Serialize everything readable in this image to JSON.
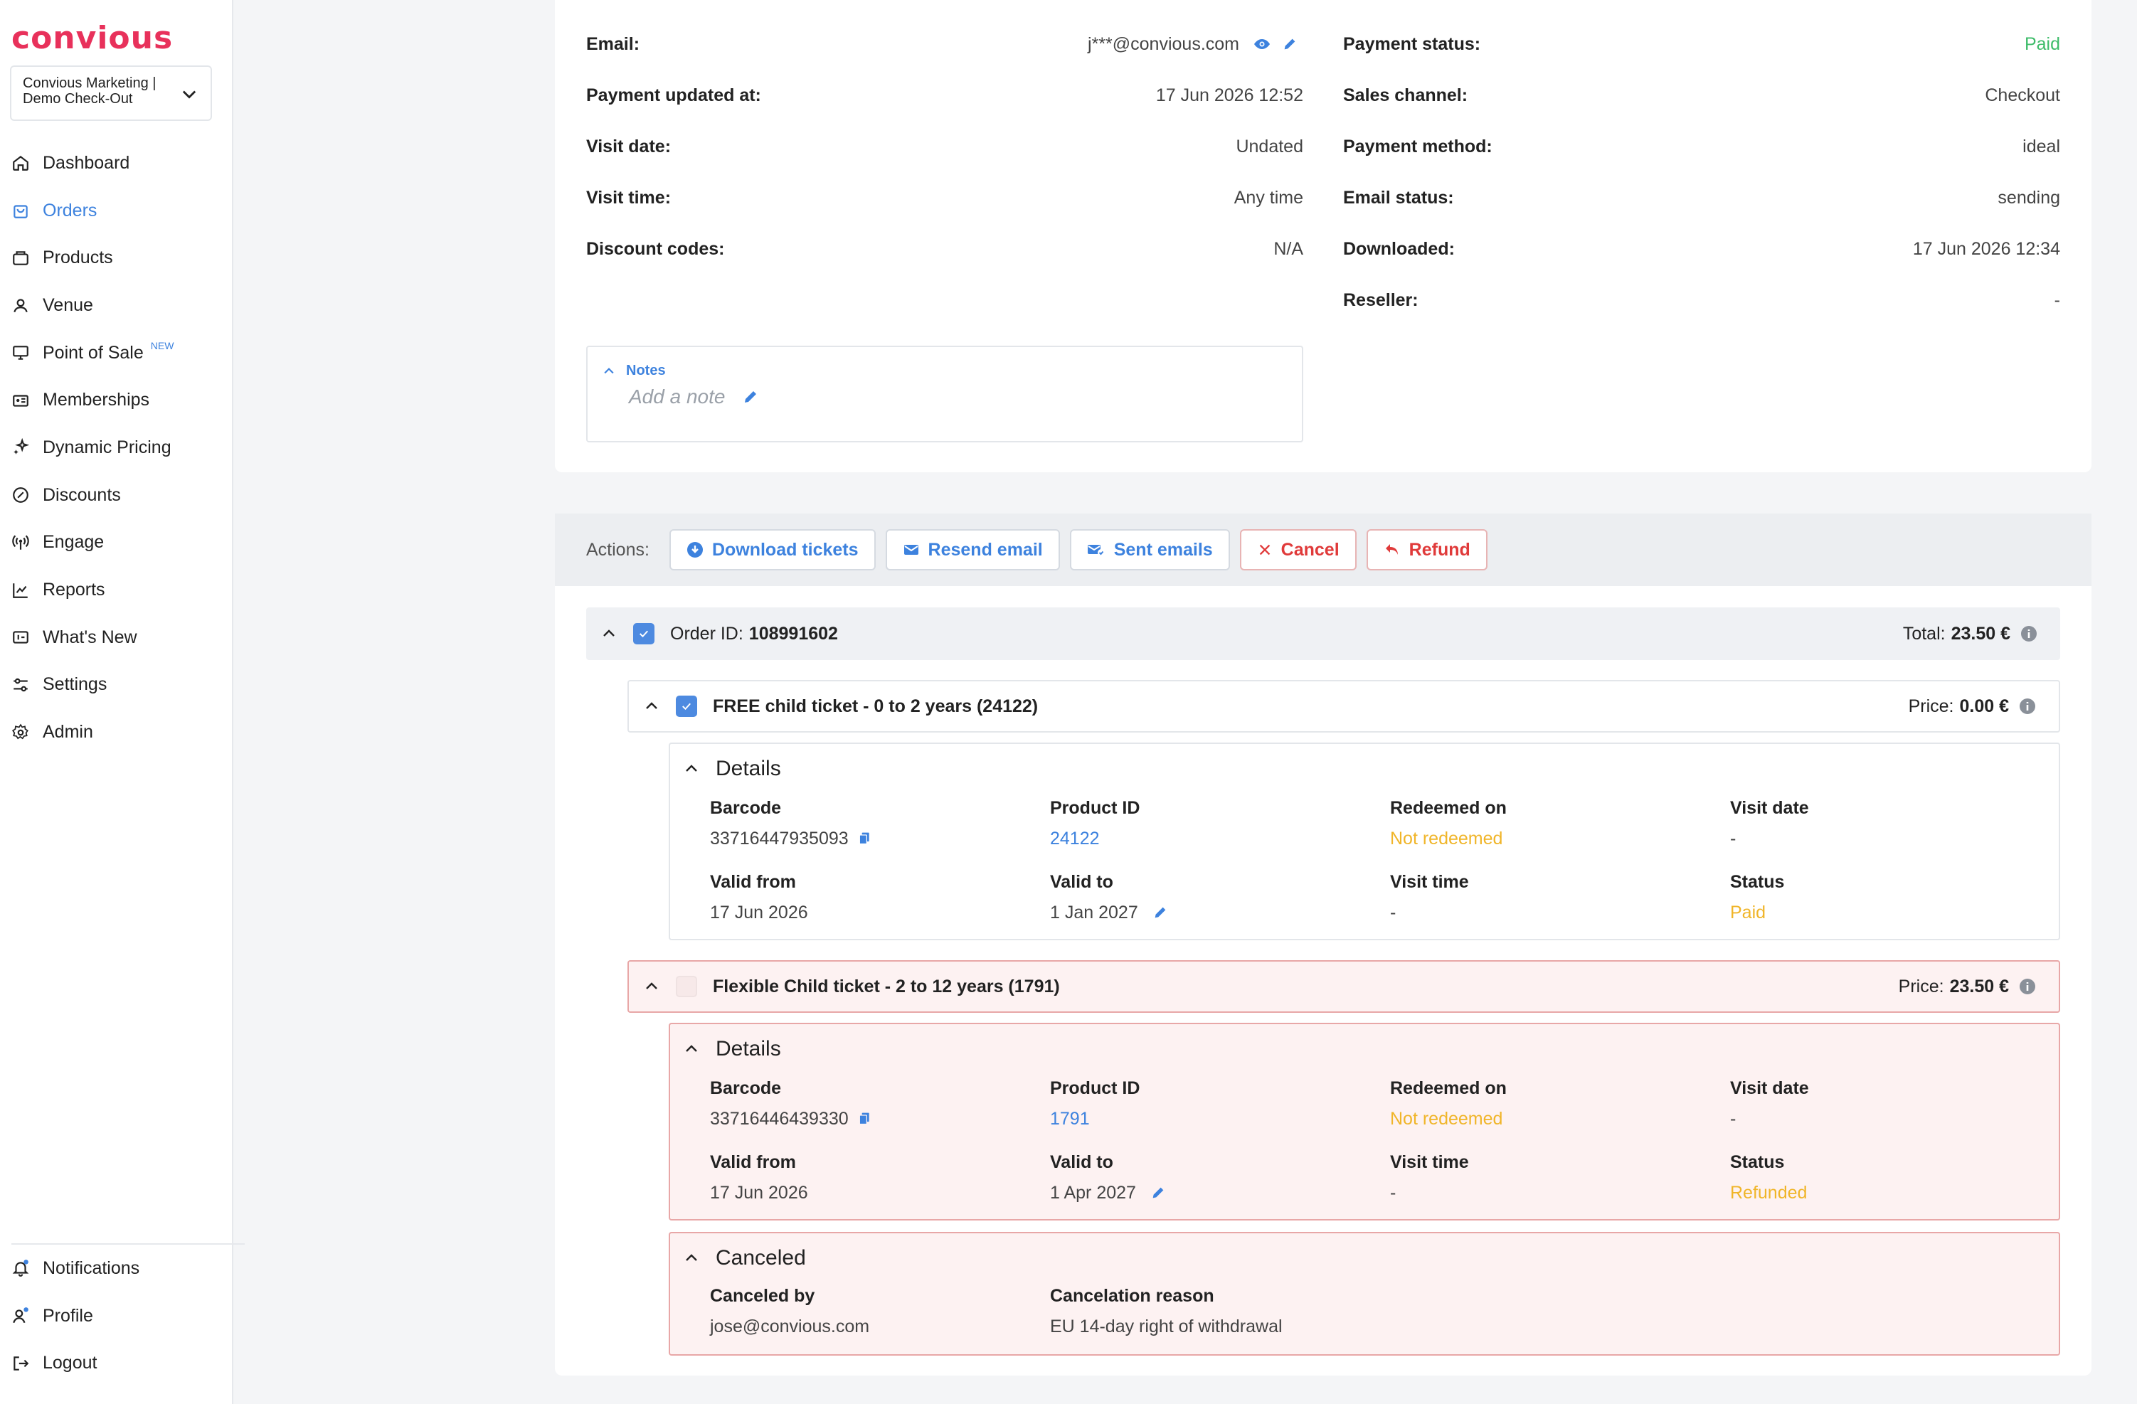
{
  "brand": {
    "logo": "convious"
  },
  "account": {
    "line1": "Convious Marketing |",
    "line2": "Demo Check-Out"
  },
  "sidebar": {
    "items": [
      {
        "label": "Dashboard",
        "icon": "home-icon"
      },
      {
        "label": "Orders",
        "icon": "bag-icon",
        "active": true
      },
      {
        "label": "Products",
        "icon": "ticket-icon"
      },
      {
        "label": "Venue",
        "icon": "location-icon"
      },
      {
        "label": "Point of Sale",
        "icon": "monitor-icon",
        "badge": "NEW"
      },
      {
        "label": "Memberships",
        "icon": "id-card-icon"
      },
      {
        "label": "Dynamic Pricing",
        "icon": "sparkles-icon"
      },
      {
        "label": "Discounts",
        "icon": "discount-icon"
      },
      {
        "label": "Engage",
        "icon": "broadcast-icon"
      },
      {
        "label": "Reports",
        "icon": "chart-icon"
      },
      {
        "label": "What's New",
        "icon": "news-icon"
      },
      {
        "label": "Settings",
        "icon": "sliders-icon"
      },
      {
        "label": "Admin",
        "icon": "gear-icon"
      }
    ],
    "bottom": [
      {
        "label": "Notifications",
        "icon": "bell-icon"
      },
      {
        "label": "Profile",
        "icon": "user-icon"
      },
      {
        "label": "Logout",
        "icon": "logout-icon"
      }
    ]
  },
  "order_info": {
    "left": [
      {
        "label": "Email:",
        "value": "j***@convious.com"
      },
      {
        "label": "Payment updated at:",
        "value": "17 Jun 2026 12:52"
      },
      {
        "label": "Visit date:",
        "value": "Undated"
      },
      {
        "label": "Visit time:",
        "value": "Any time"
      },
      {
        "label": "Discount codes:",
        "value": "N/A"
      }
    ],
    "right": [
      {
        "label": "Payment status:",
        "value": "Paid",
        "color": "#3ebc6a"
      },
      {
        "label": "Sales channel:",
        "value": "Checkout"
      },
      {
        "label": "Payment method:",
        "value": "ideal"
      },
      {
        "label": "Email status:",
        "value": "sending"
      },
      {
        "label": "Downloaded:",
        "value": "17 Jun 2026 12:34"
      },
      {
        "label": "Reseller:",
        "value": "-"
      }
    ]
  },
  "notes": {
    "title": "Notes",
    "placeholder": "Add a note"
  },
  "actions": {
    "label": "Actions:",
    "download": "Download tickets",
    "resend": "Resend email",
    "sent": "Sent emails",
    "cancel": "Cancel",
    "refund": "Refund"
  },
  "order": {
    "id_label": "Order ID:",
    "id": "108991602",
    "total_label": "Total:",
    "total": "23.50 €"
  },
  "items": [
    {
      "title": "FREE child ticket - 0 to 2 years (24122)",
      "price_label": "Price:",
      "price": "0.00 €",
      "details_title": "Details",
      "barcode_label": "Barcode",
      "barcode": "33716447935093",
      "product_label": "Product ID",
      "product": "24122",
      "redeemed_label": "Redeemed on",
      "redeemed": "Not redeemed",
      "visit_date_label": "Visit date",
      "visit_date": "-",
      "valid_from_label": "Valid from",
      "valid_from": "17 Jun 2026",
      "valid_to_label": "Valid to",
      "valid_to": "1 Jan 2027",
      "visit_time_label": "Visit time",
      "visit_time": "-",
      "status_label": "Status",
      "status": "Paid"
    },
    {
      "title": "Flexible Child ticket - 2 to 12 years (1791)",
      "price_label": "Price:",
      "price": "23.50 €",
      "details_title": "Details",
      "barcode_label": "Barcode",
      "barcode": "33716446439330",
      "product_label": "Product ID",
      "product": "1791",
      "redeemed_label": "Redeemed on",
      "redeemed": "Not redeemed",
      "visit_date_label": "Visit date",
      "visit_date": "-",
      "valid_from_label": "Valid from",
      "valid_from": "17 Jun 2026",
      "valid_to_label": "Valid to",
      "valid_to": "1 Apr 2027",
      "visit_time_label": "Visit time",
      "visit_time": "-",
      "status_label": "Status",
      "status": "Refunded",
      "canceled_title": "Canceled",
      "canceled_by_label": "Canceled by",
      "canceled_by": "jose@convious.com",
      "reason_label": "Cancelation reason",
      "reason": "EU 14-day right of withdrawal"
    }
  ],
  "colors": {
    "accent": "#3d82de",
    "brand": "#e8315b",
    "danger": "#e03a3a",
    "warning": "#f0b529",
    "success": "#3ebc6a"
  }
}
